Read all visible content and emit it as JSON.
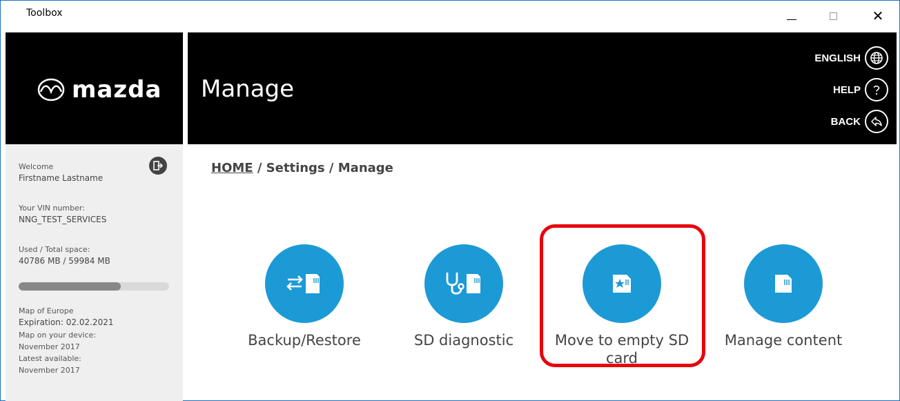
{
  "window": {
    "title": "Toolbox",
    "controls": {
      "minimize": "minimize",
      "maximize": "maximize",
      "close": "✕"
    }
  },
  "header": {
    "brand": "mazda",
    "page_title": "Manage",
    "links": [
      {
        "label": "ENGLISH",
        "icon": "globe-icon"
      },
      {
        "label": "HELP",
        "icon": "help-icon"
      },
      {
        "label": "BACK",
        "icon": "back-icon"
      }
    ]
  },
  "sidebar": {
    "welcome_label": "Welcome",
    "user_name": "Firstname Lastname",
    "vin_label": "Your VIN number:",
    "vin_value": "NNG_TEST_SERVICES",
    "space_label": "Used / Total space:",
    "space_value": "40786 MB / 59984 MB",
    "space_used_fraction": 0.68,
    "map_name": "Map of Europe",
    "expiration": "Expiration: 02.02.2021",
    "device_map_label": "Map on your device:",
    "device_map_value": "November 2017",
    "latest_label": "Latest available:",
    "latest_value": "November 2017"
  },
  "breadcrumb": {
    "home": "HOME",
    "rest": " / Settings / Manage"
  },
  "tiles": [
    {
      "label": "Backup/Restore",
      "icon": "backup-restore-icon"
    },
    {
      "label": "SD diagnostic",
      "icon": "sd-diagnostic-icon"
    },
    {
      "label": "Move to empty SD card",
      "icon": "move-sd-card-icon"
    },
    {
      "label": "Manage content",
      "icon": "sd-card-icon"
    }
  ],
  "colors": {
    "accent": "#1c9ad6",
    "highlight": "#e8000b",
    "header_bg": "#000000",
    "sidebar_bg": "#efefef"
  }
}
